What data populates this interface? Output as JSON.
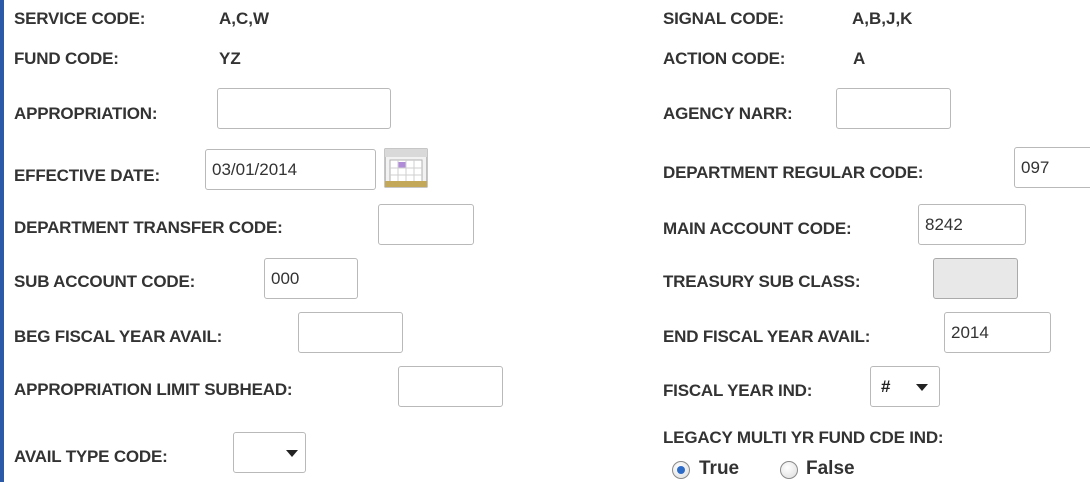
{
  "left": {
    "service_code": {
      "label": "SERVICE CODE:",
      "value": "A,C,W"
    },
    "fund_code": {
      "label": "FUND CODE:",
      "value": "YZ"
    },
    "appropriation": {
      "label": "APPROPRIATION:",
      "value": ""
    },
    "effective_date": {
      "label": "EFFECTIVE DATE:",
      "value": "03/01/2014"
    },
    "department_transfer_code": {
      "label": "DEPARTMENT TRANSFER CODE:",
      "value": ""
    },
    "sub_account_code": {
      "label": "SUB ACCOUNT CODE:",
      "value": "000"
    },
    "beg_fiscal_year_avail": {
      "label": "BEG FISCAL YEAR AVAIL:",
      "value": ""
    },
    "appropriation_limit_subhead": {
      "label": "APPROPRIATION LIMIT SUBHEAD:",
      "value": ""
    },
    "avail_type_code": {
      "label": "AVAIL TYPE CODE:",
      "value": ""
    }
  },
  "right": {
    "signal_code": {
      "label": "SIGNAL CODE:",
      "value": "A,B,J,K"
    },
    "action_code": {
      "label": "ACTION CODE:",
      "value": "A"
    },
    "agency_narr": {
      "label": "AGENCY NARR:",
      "value": ""
    },
    "department_regular_code": {
      "label": "DEPARTMENT REGULAR CODE:",
      "value": "097"
    },
    "main_account_code": {
      "label": "MAIN ACCOUNT CODE:",
      "value": "8242"
    },
    "treasury_sub_class": {
      "label": "TREASURY SUB CLASS:",
      "value": ""
    },
    "end_fiscal_year_avail": {
      "label": "END FISCAL YEAR AVAIL:",
      "value": "2014"
    },
    "fiscal_year_ind": {
      "label": "FISCAL YEAR IND:",
      "value": "#"
    },
    "legacy_multi_yr": {
      "label": "LEGACY MULTI YR FUND CDE IND:",
      "options": [
        "True",
        "False"
      ],
      "selected": "True"
    }
  },
  "icons": {
    "calendar": "calendar-icon",
    "dropdown": "chevron-down-icon"
  },
  "colors": {
    "accent": "#2a5aa8",
    "radio_selected": "#2d6bc8",
    "disabled_field": "#e8e8e8"
  }
}
